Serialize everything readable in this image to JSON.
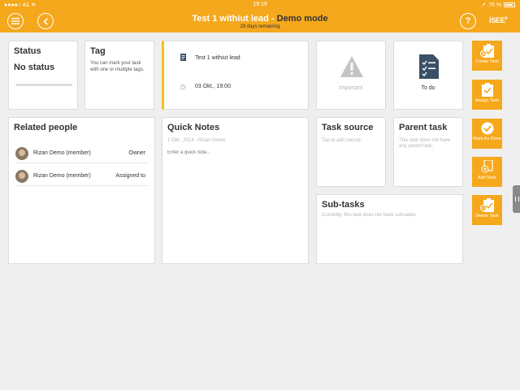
{
  "statusbar": {
    "carrier": "A1",
    "time": "19:19",
    "battery": "76 %"
  },
  "header": {
    "task_title": "Test 1 withiut lead",
    "separator": " - ",
    "mode": "Demo mode",
    "remaining": "29 days remaining",
    "logo": {
      "lead": "i",
      "word": "SEE",
      "suffix": "it"
    }
  },
  "status": {
    "title": "Status",
    "value": "No status"
  },
  "tag": {
    "title": "Tag",
    "description": "You can mark your task with one or multiple tags."
  },
  "task": {
    "name": "Test 1 withiut lead",
    "date": "03 Okt., 19:00"
  },
  "important": {
    "label": "Important"
  },
  "todo": {
    "label": "To do"
  },
  "related_people": {
    "title": "Related people",
    "people": [
      {
        "name": "Rizan Demo (member)",
        "role": "Owner"
      },
      {
        "name": "Rizan Demo (member)",
        "role": "Assigned to"
      }
    ]
  },
  "quick_notes": {
    "title": "Quick Notes",
    "meta": "1 Okt., 2014 - Rizan Demo",
    "placeholder": "Enter a quick note..."
  },
  "task_source": {
    "title": "Task source",
    "hint": "Tap to add source."
  },
  "parent_task": {
    "title": "Parent task",
    "hint": "This task does not have any parent task."
  },
  "subtasks": {
    "title": "Sub-tasks",
    "hint": "Currently, this task does not have sub-tasks."
  },
  "actions": {
    "create": "Create Task",
    "assign": "Assign Task",
    "done": "Mark As Done",
    "note": "Add Note",
    "delete": "Delete Task"
  },
  "colors": {
    "accent": "#f5a81c",
    "task_bar": "#f5c116",
    "dark_icon": "#3a5066"
  }
}
